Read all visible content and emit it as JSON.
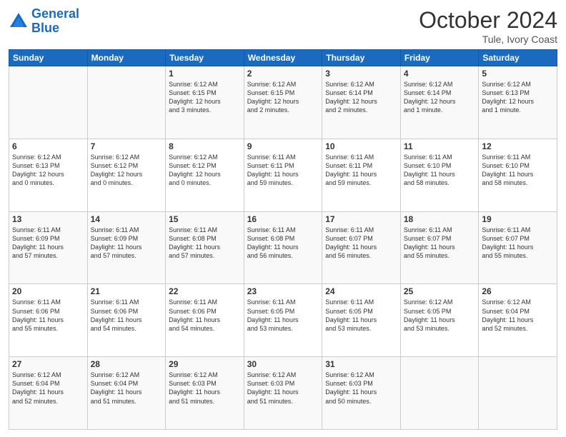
{
  "header": {
    "logo_line1": "General",
    "logo_line2": "Blue",
    "month": "October 2024",
    "location": "Tule, Ivory Coast"
  },
  "weekdays": [
    "Sunday",
    "Monday",
    "Tuesday",
    "Wednesday",
    "Thursday",
    "Friday",
    "Saturday"
  ],
  "weeks": [
    [
      {
        "day": "",
        "info": ""
      },
      {
        "day": "",
        "info": ""
      },
      {
        "day": "1",
        "info": "Sunrise: 6:12 AM\nSunset: 6:15 PM\nDaylight: 12 hours\nand 3 minutes."
      },
      {
        "day": "2",
        "info": "Sunrise: 6:12 AM\nSunset: 6:15 PM\nDaylight: 12 hours\nand 2 minutes."
      },
      {
        "day": "3",
        "info": "Sunrise: 6:12 AM\nSunset: 6:14 PM\nDaylight: 12 hours\nand 2 minutes."
      },
      {
        "day": "4",
        "info": "Sunrise: 6:12 AM\nSunset: 6:14 PM\nDaylight: 12 hours\nand 1 minute."
      },
      {
        "day": "5",
        "info": "Sunrise: 6:12 AM\nSunset: 6:13 PM\nDaylight: 12 hours\nand 1 minute."
      }
    ],
    [
      {
        "day": "6",
        "info": "Sunrise: 6:12 AM\nSunset: 6:13 PM\nDaylight: 12 hours\nand 0 minutes."
      },
      {
        "day": "7",
        "info": "Sunrise: 6:12 AM\nSunset: 6:12 PM\nDaylight: 12 hours\nand 0 minutes."
      },
      {
        "day": "8",
        "info": "Sunrise: 6:12 AM\nSunset: 6:12 PM\nDaylight: 12 hours\nand 0 minutes."
      },
      {
        "day": "9",
        "info": "Sunrise: 6:11 AM\nSunset: 6:11 PM\nDaylight: 11 hours\nand 59 minutes."
      },
      {
        "day": "10",
        "info": "Sunrise: 6:11 AM\nSunset: 6:11 PM\nDaylight: 11 hours\nand 59 minutes."
      },
      {
        "day": "11",
        "info": "Sunrise: 6:11 AM\nSunset: 6:10 PM\nDaylight: 11 hours\nand 58 minutes."
      },
      {
        "day": "12",
        "info": "Sunrise: 6:11 AM\nSunset: 6:10 PM\nDaylight: 11 hours\nand 58 minutes."
      }
    ],
    [
      {
        "day": "13",
        "info": "Sunrise: 6:11 AM\nSunset: 6:09 PM\nDaylight: 11 hours\nand 57 minutes."
      },
      {
        "day": "14",
        "info": "Sunrise: 6:11 AM\nSunset: 6:09 PM\nDaylight: 11 hours\nand 57 minutes."
      },
      {
        "day": "15",
        "info": "Sunrise: 6:11 AM\nSunset: 6:08 PM\nDaylight: 11 hours\nand 57 minutes."
      },
      {
        "day": "16",
        "info": "Sunrise: 6:11 AM\nSunset: 6:08 PM\nDaylight: 11 hours\nand 56 minutes."
      },
      {
        "day": "17",
        "info": "Sunrise: 6:11 AM\nSunset: 6:07 PM\nDaylight: 11 hours\nand 56 minutes."
      },
      {
        "day": "18",
        "info": "Sunrise: 6:11 AM\nSunset: 6:07 PM\nDaylight: 11 hours\nand 55 minutes."
      },
      {
        "day": "19",
        "info": "Sunrise: 6:11 AM\nSunset: 6:07 PM\nDaylight: 11 hours\nand 55 minutes."
      }
    ],
    [
      {
        "day": "20",
        "info": "Sunrise: 6:11 AM\nSunset: 6:06 PM\nDaylight: 11 hours\nand 55 minutes."
      },
      {
        "day": "21",
        "info": "Sunrise: 6:11 AM\nSunset: 6:06 PM\nDaylight: 11 hours\nand 54 minutes."
      },
      {
        "day": "22",
        "info": "Sunrise: 6:11 AM\nSunset: 6:06 PM\nDaylight: 11 hours\nand 54 minutes."
      },
      {
        "day": "23",
        "info": "Sunrise: 6:11 AM\nSunset: 6:05 PM\nDaylight: 11 hours\nand 53 minutes."
      },
      {
        "day": "24",
        "info": "Sunrise: 6:11 AM\nSunset: 6:05 PM\nDaylight: 11 hours\nand 53 minutes."
      },
      {
        "day": "25",
        "info": "Sunrise: 6:12 AM\nSunset: 6:05 PM\nDaylight: 11 hours\nand 53 minutes."
      },
      {
        "day": "26",
        "info": "Sunrise: 6:12 AM\nSunset: 6:04 PM\nDaylight: 11 hours\nand 52 minutes."
      }
    ],
    [
      {
        "day": "27",
        "info": "Sunrise: 6:12 AM\nSunset: 6:04 PM\nDaylight: 11 hours\nand 52 minutes."
      },
      {
        "day": "28",
        "info": "Sunrise: 6:12 AM\nSunset: 6:04 PM\nDaylight: 11 hours\nand 51 minutes."
      },
      {
        "day": "29",
        "info": "Sunrise: 6:12 AM\nSunset: 6:03 PM\nDaylight: 11 hours\nand 51 minutes."
      },
      {
        "day": "30",
        "info": "Sunrise: 6:12 AM\nSunset: 6:03 PM\nDaylight: 11 hours\nand 51 minutes."
      },
      {
        "day": "31",
        "info": "Sunrise: 6:12 AM\nSunset: 6:03 PM\nDaylight: 11 hours\nand 50 minutes."
      },
      {
        "day": "",
        "info": ""
      },
      {
        "day": "",
        "info": ""
      }
    ]
  ]
}
